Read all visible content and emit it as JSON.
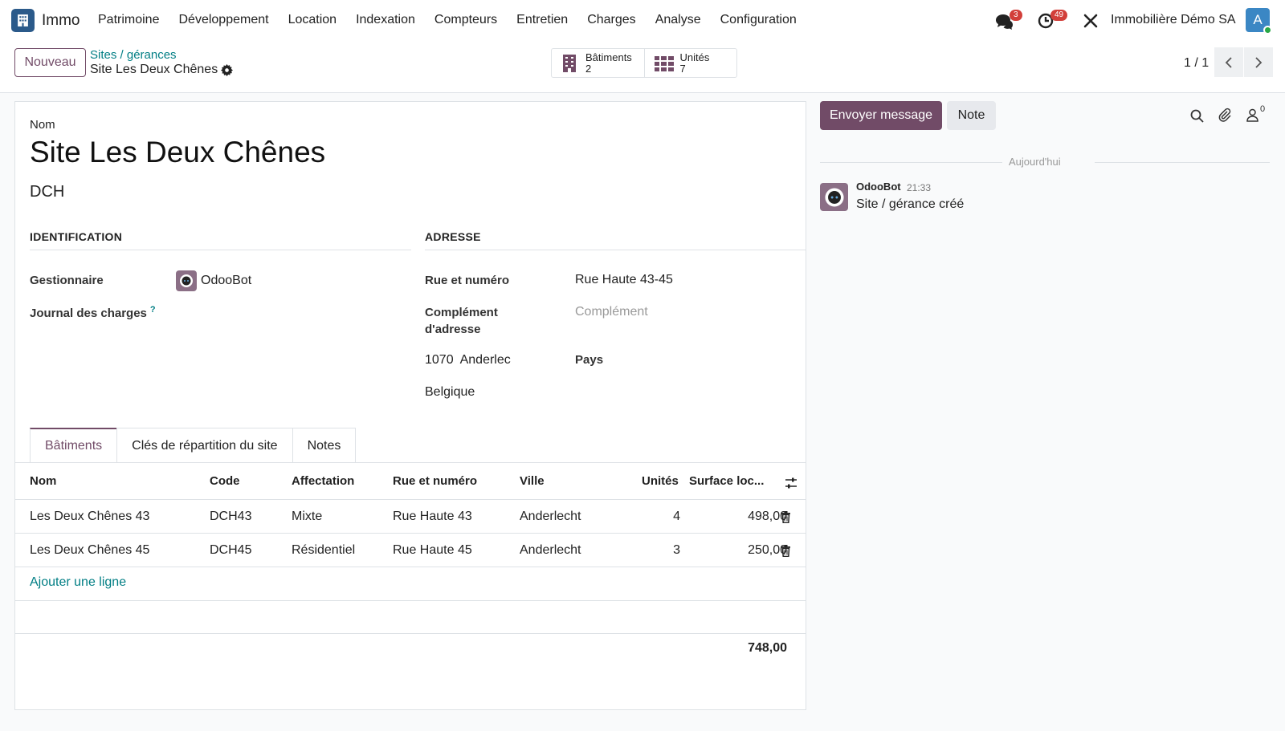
{
  "topbar": {
    "app_name": "Immo",
    "menu": [
      "Patrimoine",
      "Développement",
      "Location",
      "Indexation",
      "Compteurs",
      "Entretien",
      "Charges",
      "Analyse",
      "Configuration"
    ],
    "messages_badge": "3",
    "activities_badge": "49",
    "company": "Immobilière Démo SA",
    "user_initial": "A"
  },
  "control_panel": {
    "new_label": "Nouveau",
    "breadcrumb_parent": "Sites / gérances",
    "breadcrumb_current": "Site Les Deux Chênes",
    "smart_buttons": [
      {
        "label": "Bâtiments",
        "count": "2",
        "icon": "building-icon"
      },
      {
        "label": "Unités",
        "count": "7",
        "icon": "grid-icon"
      }
    ],
    "pager": "1 / 1"
  },
  "form": {
    "name_label": "Nom",
    "name": "Site Les Deux Chênes",
    "code": "DCH",
    "identification_title": "IDENTIFICATION",
    "address_title": "ADRESSE",
    "manager_label": "Gestionnaire",
    "manager_value": "OdooBot",
    "journal_label": "Journal des charges",
    "journal_help": "?",
    "street_label": "Rue et numéro",
    "street_value": "Rue Haute 43-45",
    "complement_label_1": "Complément",
    "complement_label_2": "d'adresse",
    "complement_placeholder": "Complément",
    "zip_city": "1070  Anderlec",
    "country_label": "Pays",
    "country_value": "Belgique"
  },
  "tabs": [
    "Bâtiments",
    "Clés de répartition du site",
    "Notes"
  ],
  "table": {
    "headers": [
      "Nom",
      "Code",
      "Affectation",
      "Rue et numéro",
      "Ville",
      "Unités",
      "Surface loc..."
    ],
    "rows": [
      [
        "Les Deux Chênes 43",
        "DCH43",
        "Mixte",
        "Rue Haute 43",
        "Anderlecht",
        "4",
        "498,00"
      ],
      [
        "Les Deux Chênes 45",
        "DCH45",
        "Résidentiel",
        "Rue Haute 45",
        "Anderlecht",
        "3",
        "250,00"
      ]
    ],
    "add_line": "Ajouter une ligne",
    "total": "748,00"
  },
  "chatter": {
    "send_label": "Envoyer message",
    "note_label": "Note",
    "followers_count": "0",
    "date_separator": "Aujourd'hui",
    "message": {
      "author": "OdooBot",
      "time": "21:33",
      "body": "Site / gérance créé"
    }
  },
  "colors": {
    "brand": "#714b67",
    "link": "#017e84",
    "badge": "#d23f3a"
  }
}
